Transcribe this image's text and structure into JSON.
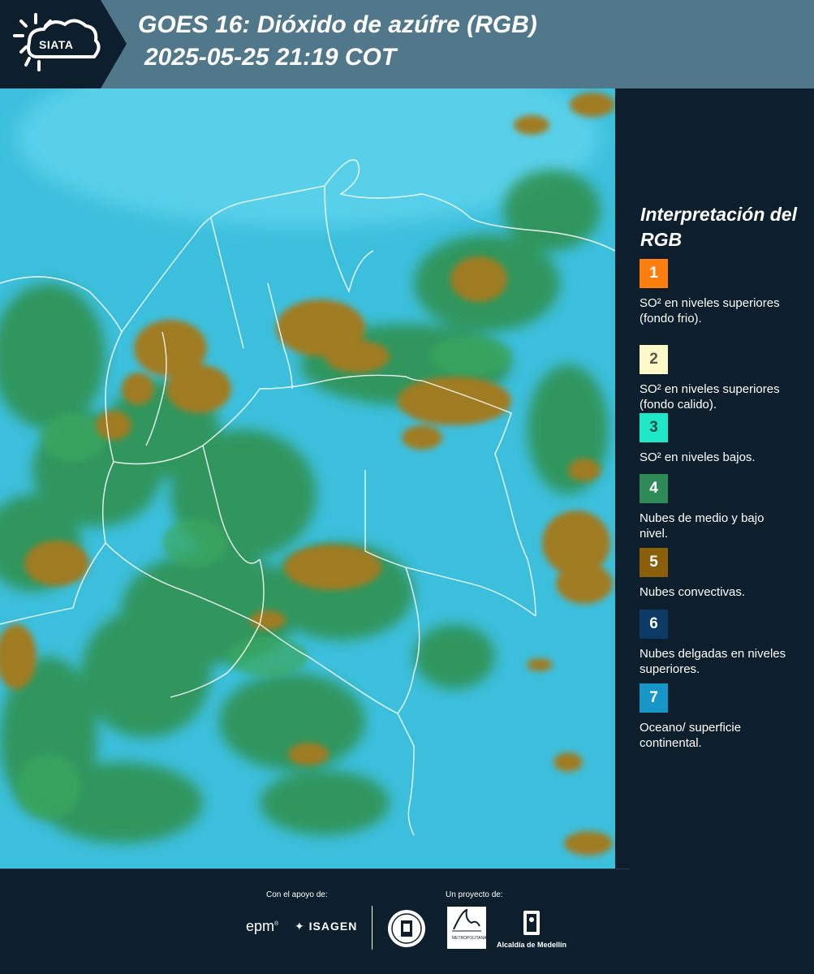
{
  "header": {
    "logo_text": "SIATA",
    "title_line1": "GOES 16: Dióxido de azúfre (RGB)",
    "title_line2": "2025-05-25 21:19 COT"
  },
  "legend": {
    "title": "Interpretación del RGB",
    "items": [
      {
        "number": "1",
        "label": "SO² en niveles superiores (fondo frio).",
        "color": "#ff7f0e",
        "text_color": "#ffffff"
      },
      {
        "number": "2",
        "label": "SO² en niveles superiores (fondo calido).",
        "color": "#fff8c8",
        "text_color": "#555555"
      },
      {
        "number": "3",
        "label": "SO² en niveles bajos.",
        "color": "#1de9c8",
        "text_color": "#1a4d46"
      },
      {
        "number": "4",
        "label": "Nubes de medio y bajo nivel.",
        "color": "#2e8b57",
        "text_color": "#ffffff"
      },
      {
        "number": "5",
        "label": "Nubes convectivas.",
        "color": "#8b5e0a",
        "text_color": "#ffffff"
      },
      {
        "number": "6",
        "label": "Nubes delgadas en niveles superiores.",
        "color": "#0b3a66",
        "text_color": "#ffffff"
      },
      {
        "number": "7",
        "label": "Oceano/ superficie continental.",
        "color": "#1796c8",
        "text_color": "#ffffff"
      }
    ]
  },
  "footer": {
    "support_label": "Con el apoyo de:",
    "project_label": "Un proyecto de:",
    "sponsors": [
      "epm",
      "ISAGEN"
    ],
    "partners": [
      "Área Metropolitana Valle de Aburrá",
      "Alcaldía de Medellín"
    ],
    "area_label": "METROPOLITANA",
    "alcaldia_label": "Alcaldía de Medellín"
  },
  "map": {
    "icon": "satellite-rgb-image",
    "background_color": "#3cbfdc",
    "cloud_colors": {
      "convective": "#9a7a1e",
      "mid_low": "#2f8f4a"
    }
  }
}
